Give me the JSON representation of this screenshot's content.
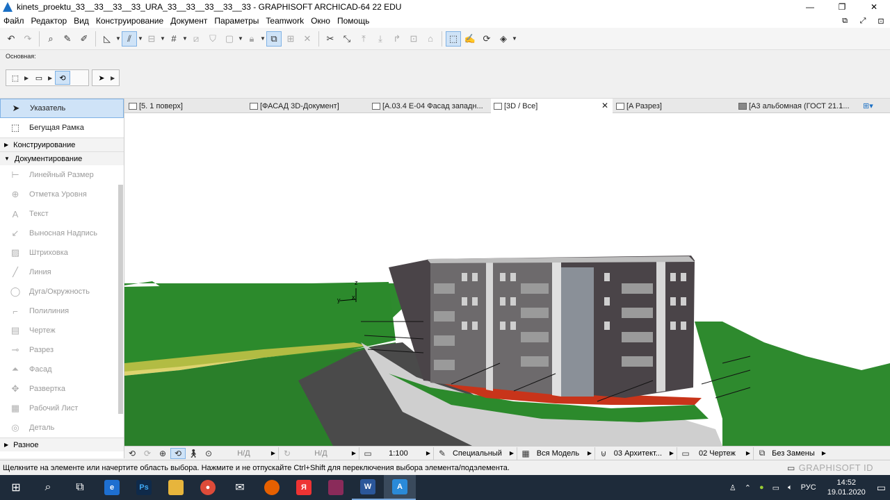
{
  "window": {
    "title": "kinets_proektu_33__33__33__33_URA_33__33__33__33__33 - GRAPHISOFT ARCHICAD-64 22 EDU",
    "minimize": "—",
    "maximize": "❐",
    "close": "✕"
  },
  "menu": {
    "items": [
      "Файл",
      "Редактор",
      "Вид",
      "Конструирование",
      "Документ",
      "Параметры",
      "Teamwork",
      "Окно",
      "Помощь"
    ],
    "right_icons": [
      "⧉",
      "⤢",
      "⊡"
    ]
  },
  "infobox": {
    "label": "Основная:"
  },
  "toolbox": {
    "top_tools": [
      {
        "label": "Указатель",
        "icon": "arrow-pointer-icon"
      },
      {
        "label": "Бегущая Рамка",
        "icon": "marquee-icon"
      }
    ],
    "sections": {
      "design": "Конструирование",
      "documentation": "Документирование",
      "misc": "Разное"
    },
    "doc_tools": [
      {
        "label": "Линейный Размер",
        "icon": "dimension-icon"
      },
      {
        "label": "Отметка Уровня",
        "icon": "level-icon"
      },
      {
        "label": "Текст",
        "icon": "text-icon"
      },
      {
        "label": "Выносная Надпись",
        "icon": "label-icon"
      },
      {
        "label": "Штриховка",
        "icon": "fill-icon"
      },
      {
        "label": "Линия",
        "icon": "line-icon"
      },
      {
        "label": "Дуга/Окружность",
        "icon": "arc-icon"
      },
      {
        "label": "Полилиния",
        "icon": "polyline-icon"
      },
      {
        "label": "Чертеж",
        "icon": "drawing-icon"
      },
      {
        "label": "Разрез",
        "icon": "section-icon"
      },
      {
        "label": "Фасад",
        "icon": "elevation-icon"
      },
      {
        "label": "Развертка",
        "icon": "interior-elevation-icon"
      },
      {
        "label": "Рабочий Лист",
        "icon": "worksheet-icon"
      },
      {
        "label": "Деталь",
        "icon": "detail-icon"
      }
    ]
  },
  "tabs": [
    {
      "label": "[5. 1 поверх]"
    },
    {
      "label": "[ФАСАД 3D-Документ]"
    },
    {
      "label": "[A.03.4 E-04 Фасад западн..."
    },
    {
      "label": "[3D / Все]"
    },
    {
      "label": "[A Разрез]"
    },
    {
      "label": "[А3 альбомная (ГОСТ 21.1..."
    }
  ],
  "viewport": {
    "axis_z": "z",
    "axis_y": "y",
    "axis_x": "x"
  },
  "navbar": {
    "field1": "Н/Д",
    "field2": "Н/Д",
    "scale": "1:100",
    "penset": "Специальный",
    "model_view": "Вся Модель",
    "layers": "03 Архитект...",
    "dimension": "02 Чертеж",
    "renovation": "Без Замены"
  },
  "status": {
    "text": "Щелкните на элементе или начертите область выбора. Нажмите и не отпускайте Ctrl+Shift для переключения выбора элемента/подэлемента.",
    "brand": "GRAPHISOFT ID"
  },
  "taskbar": {
    "time": "14:52",
    "date": "19.01.2020",
    "lang": "РУС"
  },
  "colors": {
    "grass": "#2f8f2f",
    "facade_dark": "#4a4448",
    "facade_light": "#cfcfcf",
    "road": "#4a4a4a",
    "accent": "#1a6fc4"
  }
}
